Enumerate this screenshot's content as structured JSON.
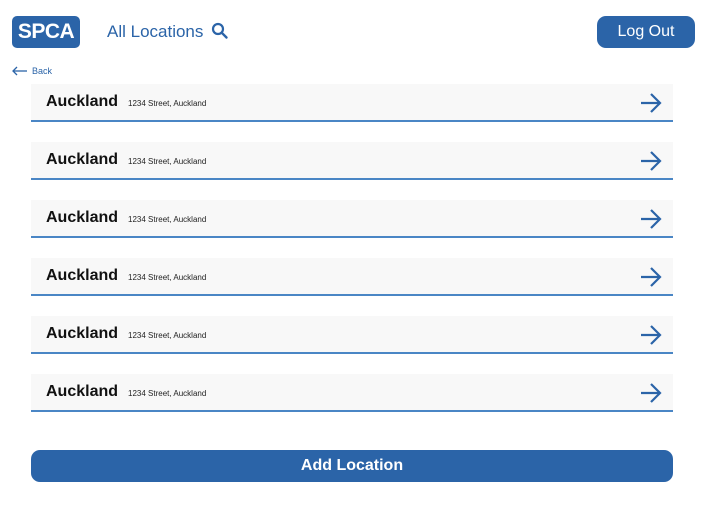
{
  "header": {
    "logo_text": "SPCA",
    "title": "All Locations",
    "search_icon": "search-icon",
    "logout_label": "Log Out"
  },
  "nav": {
    "back_label": "Back",
    "back_icon": "arrow-left-icon"
  },
  "locations": [
    {
      "name": "Auckland",
      "address": "1234 Street, Auckland"
    },
    {
      "name": "Auckland",
      "address": "1234 Street, Auckland"
    },
    {
      "name": "Auckland",
      "address": "1234 Street, Auckland"
    },
    {
      "name": "Auckland",
      "address": "1234 Street, Auckland"
    },
    {
      "name": "Auckland",
      "address": "1234 Street, Auckland"
    },
    {
      "name": "Auckland",
      "address": "1234 Street, Auckland"
    }
  ],
  "row_icon": "arrow-right-icon",
  "footer": {
    "add_label": "Add Location"
  },
  "colors": {
    "brand": "#2b64a8",
    "divider": "#4a86c5",
    "row_bg": "#f8f8f8"
  }
}
